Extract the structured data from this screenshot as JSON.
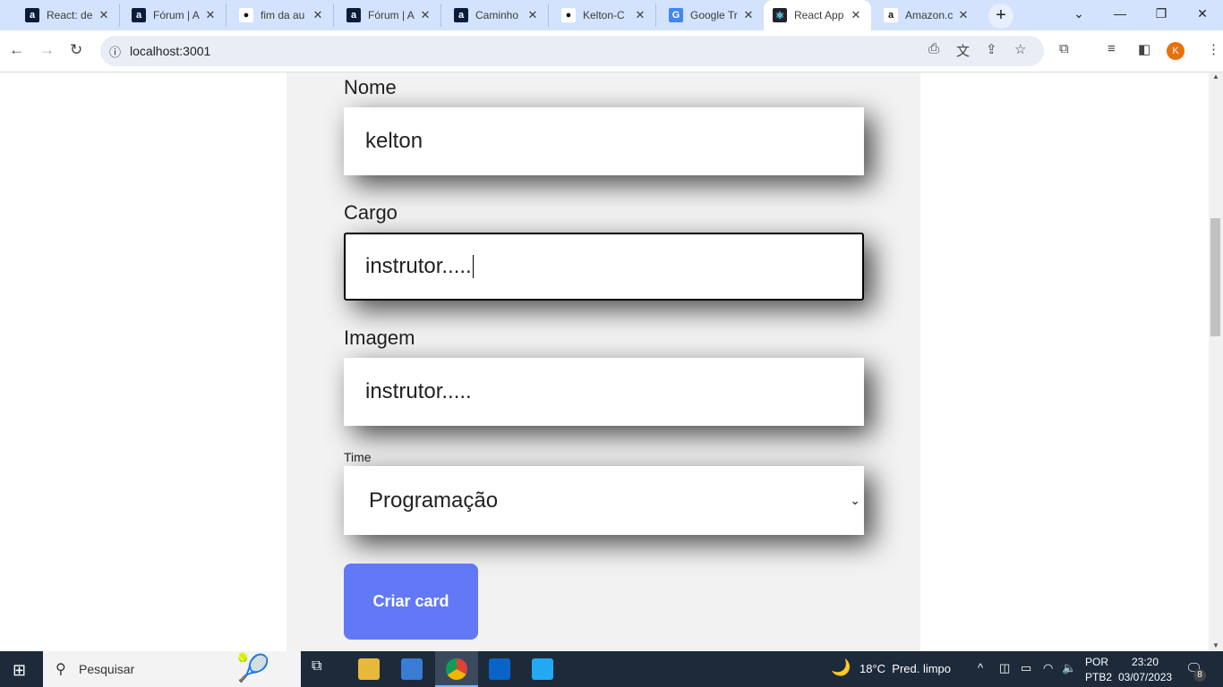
{
  "browser": {
    "tabs": [
      {
        "title": "React: de",
        "icon": "alura-icon"
      },
      {
        "title": "Fórum | A",
        "icon": "alura-icon"
      },
      {
        "title": "fim da au",
        "icon": "github-icon"
      },
      {
        "title": "Fórum | A",
        "icon": "alura-icon"
      },
      {
        "title": "Caminho",
        "icon": "alura-icon"
      },
      {
        "title": "Kelton-C",
        "icon": "github-icon"
      },
      {
        "title": "Google Tr",
        "icon": "google-translate-icon"
      },
      {
        "title": "React App",
        "icon": "react-icon",
        "active": true
      },
      {
        "title": "Amazon.c",
        "icon": "amazon-icon"
      }
    ],
    "url": "localhost:3001",
    "profile_initial": "K"
  },
  "form": {
    "nome_label": "Nome",
    "nome_value": "kelton",
    "cargo_label": "Cargo",
    "cargo_value": "instrutor.....",
    "imagem_label": "Imagem",
    "imagem_value": "instrutor.....",
    "time_label": "Time",
    "time_value": "Programação",
    "submit_label": "Criar card"
  },
  "taskbar": {
    "search_placeholder": "Pesquisar",
    "weather": "18°C  Pred. limpo",
    "lang1": "POR",
    "lang2": "PTB2",
    "time": "23:20",
    "date": "03/07/2023",
    "notifications": "8"
  }
}
